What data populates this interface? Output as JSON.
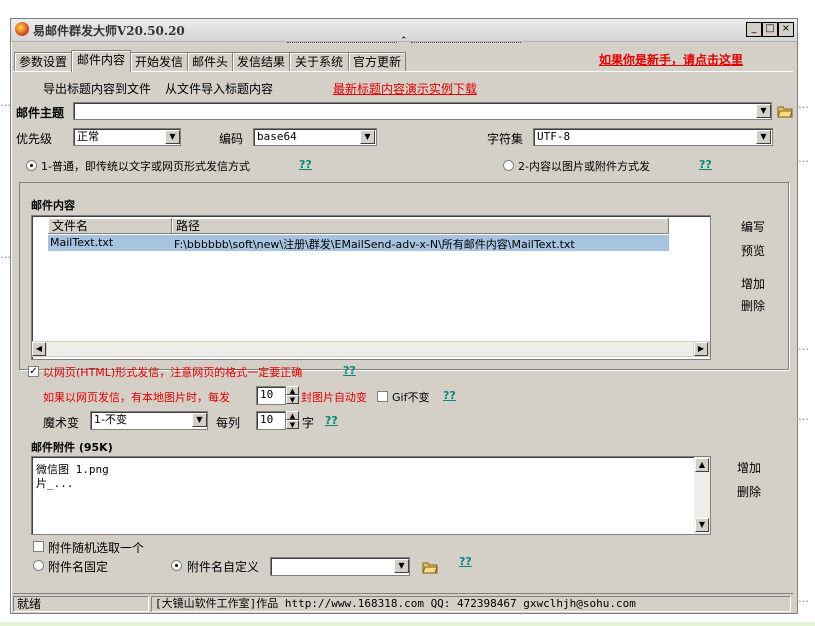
{
  "background": {
    "fragments": [
      "…",
      "…",
      "…",
      "…",
      "…",
      "…",
      "…"
    ]
  },
  "window": {
    "title": "易邮件群发大师V20.50.20",
    "min_label": "_",
    "max_label": "□",
    "close_label": "×"
  },
  "tabs": [
    {
      "label": "参数设置"
    },
    {
      "label": "邮件内容"
    },
    {
      "label": "开始发信"
    },
    {
      "label": "邮件头"
    },
    {
      "label": "发信结果"
    },
    {
      "label": "关于系统"
    },
    {
      "label": "官方更新"
    }
  ],
  "newbie_link": "如果你是新手，请点击这里",
  "toolbar": {
    "export_label": "导出标题内容到文件",
    "import_label": "从文件导入标题内容",
    "download_link": "最新标题内容演示实例下载"
  },
  "subject": {
    "label": "邮件主题",
    "value": ""
  },
  "priority": {
    "label": "优先级",
    "value": "正常"
  },
  "encoding": {
    "label": "编码",
    "value": "base64"
  },
  "charset": {
    "label": "字符集",
    "value": "UTF-8"
  },
  "send_mode": {
    "option1": "1-普通，即传统以文字或网页形式发信方式",
    "option2": "2-内容以图片或附件方式发",
    "help": "??"
  },
  "content": {
    "group_label": "邮件内容",
    "columns": [
      "文件名",
      "路径"
    ],
    "rows": [
      {
        "name": "MailText.txt",
        "path": "F:\\bbbbbb\\soft\\new\\注册\\群发\\EMailSend-adv-x-N\\所有邮件内容\\MailText.txt"
      }
    ],
    "btn_edit": "编写",
    "btn_preview": "预览",
    "btn_add": "增加",
    "btn_delete": "删除"
  },
  "html_mode": {
    "label": "以网页(HTML)形式发信，注意网页的格式一定要正确",
    "help": "??",
    "image_prefix": "如果以网页发信，有本地图片时，每发",
    "image_count": "10",
    "image_suffix": "封图片自动变",
    "gif_label": "Gif不变",
    "magic_label": "魔术变",
    "magic_value": "1-不变",
    "each_col_label": "每列",
    "col_count": "10",
    "char_label": "字"
  },
  "attachments": {
    "group_label": "邮件附件 (95K)",
    "items": [
      "微信图  1.png",
      "片_..."
    ],
    "btn_add": "增加",
    "btn_delete": "删除",
    "random_label": "附件随机选取一个",
    "fixed_label": "附件名固定",
    "custom_label": "附件名自定义",
    "custom_value": "",
    "help": "??"
  },
  "statusbar": {
    "state": "就绪",
    "credit": "[大镜山软件工作室]作品 http://www.168318.com QQ: 472398467 gxwclhjh@sohu.com"
  }
}
